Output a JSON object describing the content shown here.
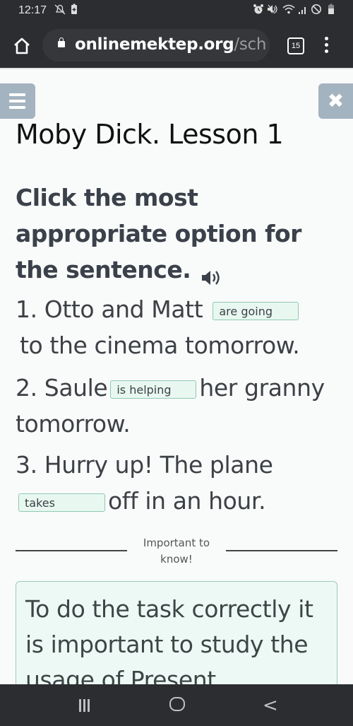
{
  "status_bar": {
    "time": "12:17",
    "icons": [
      "notifications-off-icon",
      "battery-saver-icon",
      "alarm-icon",
      "mute-icon",
      "wifi-icon",
      "signal-icon",
      "do-not-disturb-icon",
      "battery-icon"
    ]
  },
  "browser": {
    "url_domain": "onlinemektep.org",
    "url_path": "/sch",
    "tab_count": "15"
  },
  "lesson": {
    "title": "Moby Dick. Lesson 1",
    "instruction": "Click the most appropriate option for the sentence."
  },
  "questions": [
    {
      "number": "1.",
      "before": "Otto and Matt",
      "answer": "are going",
      "after": "to the cinema tomorrow."
    },
    {
      "number": "2.",
      "before": "Saule",
      "answer": "is helping",
      "after": "her granny",
      "after2": "tomorrow."
    },
    {
      "number": "3.",
      "before": "Hurry up! The plane",
      "answer": "takes",
      "after": "off in an hour."
    }
  ],
  "important": {
    "label_line1": "Important to",
    "label_line2": "know!",
    "note": "To do the task correctly it is important to study the usage of Present"
  },
  "colors": {
    "answer_border": "#8fc9b1",
    "answer_bg": "#e8f8f1",
    "side_buttons": "#a3b3bf",
    "system_bar": "#2c2d30"
  }
}
